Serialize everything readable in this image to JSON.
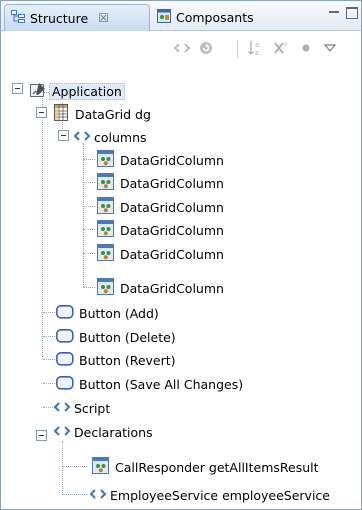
{
  "tabs": {
    "structure": {
      "label": "Structure",
      "close": "☒"
    },
    "composants": {
      "label": "Composants"
    }
  },
  "tree": {
    "application": "Application",
    "datagrid": "DataGrid dg",
    "columns": "columns",
    "column_items": [
      "DataGridColumn",
      "DataGridColumn",
      "DataGridColumn",
      "DataGridColumn",
      "DataGridColumn",
      "DataGridColumn"
    ],
    "buttons": [
      "Button (Add)",
      "Button (Delete)",
      "Button (Revert)",
      "Button (Save All Changes)"
    ],
    "script": "Script",
    "declarations": "Declarations",
    "call_responder": "CallResponder getAllItemsResult",
    "employee_service": "EmployeeService employeeService"
  },
  "colors": {
    "tag_blue": "#3a74c4",
    "button_border": "#3b63b5",
    "selection": "#dfe9f7"
  }
}
